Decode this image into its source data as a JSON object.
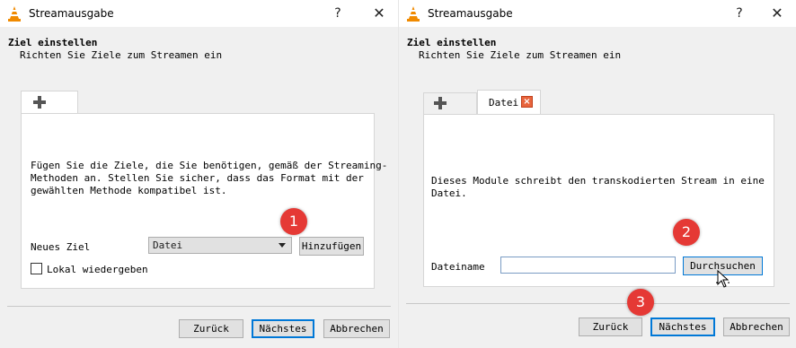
{
  "left_dialog": {
    "title": "Streamausgabe",
    "help": "?",
    "close": "✕",
    "heading": "Ziel einstellen",
    "subheading": "Richten Sie Ziele zum Streamen ein",
    "info_lines": [
      "Fügen Sie die Ziele, die Sie benötigen, gemäß der Streaming-",
      "Methoden an. Stellen Sie sicher, dass das Format mit der",
      "gewählten Methode kompatibel ist."
    ],
    "new_target_label": "Neues Ziel",
    "new_target_value": "Datei",
    "add_button": "Hinzufügen",
    "local_play_label": "Lokal wiedergeben",
    "local_play_checked": false,
    "back_button": "Zurück",
    "next_button": "Nächstes",
    "cancel_button": "Abbrechen",
    "badge": "1"
  },
  "right_dialog": {
    "title": "Streamausgabe",
    "help": "?",
    "close": "✕",
    "heading": "Ziel einstellen",
    "subheading": "Richten Sie Ziele zum Streamen ein",
    "tab_label": "Datei",
    "info_lines": [
      "Dieses Module schreibt den transkodierten Stream in eine",
      "Datei."
    ],
    "filename_label": "Dateiname",
    "filename_value": "",
    "browse_button": "Durchsuchen ···",
    "back_button": "Zurück",
    "next_button": "Nächstes",
    "cancel_button": "Abbrechen",
    "badge_browse": "2",
    "badge_next": "3"
  },
  "colors": {
    "badge": "#e53935",
    "focus_border": "#0078d7",
    "tab_close": "#e8643c"
  }
}
